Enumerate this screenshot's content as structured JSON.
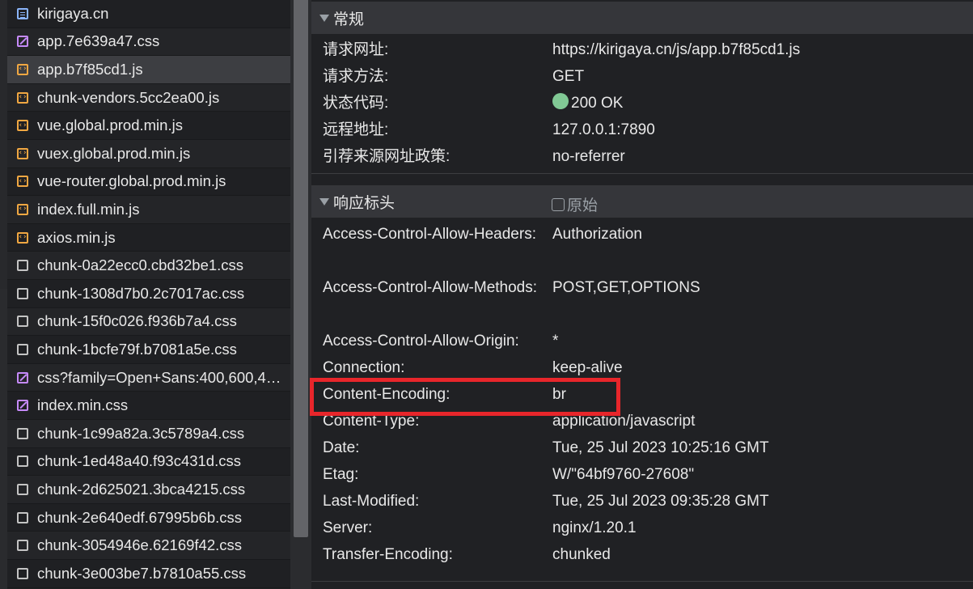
{
  "files": [
    {
      "name": "kirigaya.cn",
      "icon": "document-icon",
      "kind": "doc"
    },
    {
      "name": "app.7e639a47.css",
      "icon": "css-file-icon",
      "kind": "css"
    },
    {
      "name": "app.b7f85cd1.js",
      "icon": "js-file-icon",
      "kind": "js",
      "selected": true
    },
    {
      "name": "chunk-vendors.5cc2ea00.js",
      "icon": "js-file-icon",
      "kind": "js"
    },
    {
      "name": "vue.global.prod.min.js",
      "icon": "js-file-icon",
      "kind": "js"
    },
    {
      "name": "vuex.global.prod.min.js",
      "icon": "js-file-icon",
      "kind": "js"
    },
    {
      "name": "vue-router.global.prod.min.js",
      "icon": "js-file-icon",
      "kind": "js"
    },
    {
      "name": "index.full.min.js",
      "icon": "js-file-icon",
      "kind": "js"
    },
    {
      "name": "axios.min.js",
      "icon": "js-file-icon",
      "kind": "js"
    },
    {
      "name": "chunk-0a22ecc0.cbd32be1.css",
      "icon": "generic-file-icon",
      "kind": "other"
    },
    {
      "name": "chunk-1308d7b0.2c7017ac.css",
      "icon": "generic-file-icon",
      "kind": "other"
    },
    {
      "name": "chunk-15f0c026.f936b7a4.css",
      "icon": "generic-file-icon",
      "kind": "other"
    },
    {
      "name": "chunk-1bcfe79f.b7081a5e.css",
      "icon": "generic-file-icon",
      "kind": "other"
    },
    {
      "name": "css?family=Open+Sans:400,600,4…",
      "icon": "css-file-icon",
      "kind": "css"
    },
    {
      "name": "index.min.css",
      "icon": "css-file-icon",
      "kind": "css"
    },
    {
      "name": "chunk-1c99a82a.3c5789a4.css",
      "icon": "generic-file-icon",
      "kind": "other"
    },
    {
      "name": "chunk-1ed48a40.f93c431d.css",
      "icon": "generic-file-icon",
      "kind": "other"
    },
    {
      "name": "chunk-2d625021.3bca4215.css",
      "icon": "generic-file-icon",
      "kind": "other"
    },
    {
      "name": "chunk-2e640edf.67995b6b.css",
      "icon": "generic-file-icon",
      "kind": "other"
    },
    {
      "name": "chunk-3054946e.62169f42.css",
      "icon": "generic-file-icon",
      "kind": "other"
    },
    {
      "name": "chunk-3e003be7.b7810a55.css",
      "icon": "generic-file-icon",
      "kind": "other"
    }
  ],
  "general": {
    "title": "常规",
    "rows": [
      {
        "key": "请求网址:",
        "value": "https://kirigaya.cn/js/app.b7f85cd1.js"
      },
      {
        "key": "请求方法:",
        "value": "GET"
      },
      {
        "key": "状态代码:",
        "value": "200 OK"
      },
      {
        "key": "远程地址:",
        "value": "127.0.0.1:7890"
      },
      {
        "key": "引荐来源网址政策:",
        "value": "no-referrer"
      }
    ]
  },
  "response_headers": {
    "title": "响应标头",
    "raw_label": "原始",
    "rows": [
      {
        "key": "Access-Control-Allow-Headers:",
        "value": "Authorization"
      },
      {
        "key": "Access-Control-Allow-Methods:",
        "value": "POST,GET,OPTIONS"
      },
      {
        "key": "Access-Control-Allow-Origin:",
        "value": "*"
      },
      {
        "key": "Connection:",
        "value": "keep-alive"
      },
      {
        "key": "Content-Encoding:",
        "value": "br"
      },
      {
        "key": "Content-Type:",
        "value": "application/javascript"
      },
      {
        "key": "Date:",
        "value": "Tue, 25 Jul 2023 10:25:16 GMT"
      },
      {
        "key": "Etag:",
        "value": "W/\"64bf9760-27608\""
      },
      {
        "key": "Last-Modified:",
        "value": "Tue, 25 Jul 2023 09:35:28 GMT"
      },
      {
        "key": "Server:",
        "value": "nginx/1.20.1"
      },
      {
        "key": "Transfer-Encoding:",
        "value": "chunked"
      }
    ]
  },
  "colors": {
    "status_ok": "#81c995",
    "highlight": "#e8262b",
    "js_icon": "#f0a742",
    "css_icon": "#c58af9",
    "doc_icon": "#8ab4f8"
  }
}
